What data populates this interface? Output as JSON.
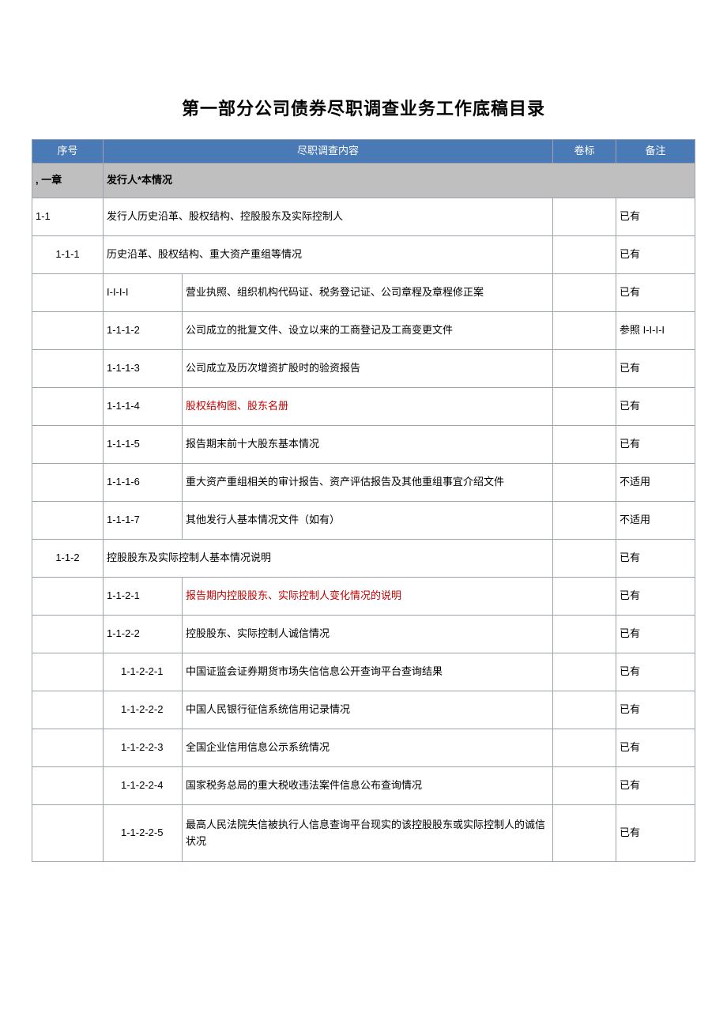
{
  "title": "第一部分公司债券尽职调查业务工作底稿目录",
  "headers": {
    "serial": "序号",
    "content": "尽职调查内容",
    "volume": "卷标",
    "note": "备注"
  },
  "chapter": {
    "idx": ", 一章",
    "label": "发行人*本情况"
  },
  "rows": [
    {
      "level": 1,
      "idx": "1-1",
      "sub": "",
      "content": "发行人历史沿革、股权结构、控股股东及实际控制人",
      "vol": "",
      "note": "已有",
      "red": false
    },
    {
      "level": 2,
      "idx": "1-1-1",
      "sub": "",
      "content": "历史沿革、股权结构、重大资产重组等情况",
      "vol": "",
      "note": "已有",
      "red": false
    },
    {
      "level": 3,
      "idx": "",
      "sub": "I-I-I-I",
      "content": "营业执照、组织机构代码证、税务登记证、公司章程及章程修正案",
      "vol": "",
      "note": "已有",
      "red": false
    },
    {
      "level": 3,
      "idx": "",
      "sub": "1-1-1-2",
      "content": "公司成立的批复文件、设立以来的工商登记及工商变更文件",
      "vol": "",
      "note": "参照 I-I-I-I",
      "red": false
    },
    {
      "level": 3,
      "idx": "",
      "sub": "1-1-1-3",
      "content": "公司成立及历次增资扩股时的验资报告",
      "vol": "",
      "note": "已有",
      "red": false
    },
    {
      "level": 3,
      "idx": "",
      "sub": "1-1-1-4",
      "content": "股权结构图、股东名册",
      "vol": "",
      "note": "已有",
      "red": true
    },
    {
      "level": 3,
      "idx": "",
      "sub": "1-1-1-5",
      "content": "报告期末前十大股东基本情况",
      "vol": "",
      "note": "已有",
      "red": false
    },
    {
      "level": 3,
      "idx": "",
      "sub": "1-1-1-6",
      "content": "重大资产重组相关的审计报告、资产评估报告及其他重组事宜介绍文件",
      "vol": "",
      "note": "不适用",
      "red": false
    },
    {
      "level": 3,
      "idx": "",
      "sub": "1-1-1-7",
      "content": "其他发行人基本情况文件（如有）",
      "vol": "",
      "note": "不适用",
      "red": false
    },
    {
      "level": 2,
      "idx": "1-1-2",
      "sub": "",
      "content": "控股股东及实际控制人基本情况说明",
      "vol": "",
      "note": "已有",
      "red": false
    },
    {
      "level": 3,
      "idx": "",
      "sub": "1-1-2-1",
      "content": "报告期内控股股东、实际控制人变化情况的说明",
      "vol": "",
      "note": "已有",
      "red": true
    },
    {
      "level": 3,
      "idx": "",
      "sub": "1-1-2-2",
      "content": "控股股东、实际控制人诚信情况",
      "vol": "",
      "note": "已有",
      "red": false
    },
    {
      "level": 4,
      "idx": "",
      "sub": "1-1-2-2-1",
      "content": "中国证监会证券期货市场失信信息公开查询平台查询结果",
      "vol": "",
      "note": "已有",
      "red": false
    },
    {
      "level": 4,
      "idx": "",
      "sub": "1-1-2-2-2",
      "content": "中国人民银行征信系统信用记录情况",
      "vol": "",
      "note": "已有",
      "red": false
    },
    {
      "level": 4,
      "idx": "",
      "sub": "1-1-2-2-3",
      "content": "全国企业信用信息公示系统情况",
      "vol": "",
      "note": "已有",
      "red": false
    },
    {
      "level": 4,
      "idx": "",
      "sub": "1-1-2-2-4",
      "content": "国家税务总局的重大税收违法案件信息公布查询情况",
      "vol": "",
      "note": "已有",
      "red": false
    },
    {
      "level": 4,
      "idx": "",
      "sub": "1-1-2-2-5",
      "content": "最高人民法院失信被执行人信息查询平台现实的该控股股东或实际控制人的诚信状况",
      "vol": "",
      "note": "已有",
      "red": false,
      "tall": true
    }
  ]
}
